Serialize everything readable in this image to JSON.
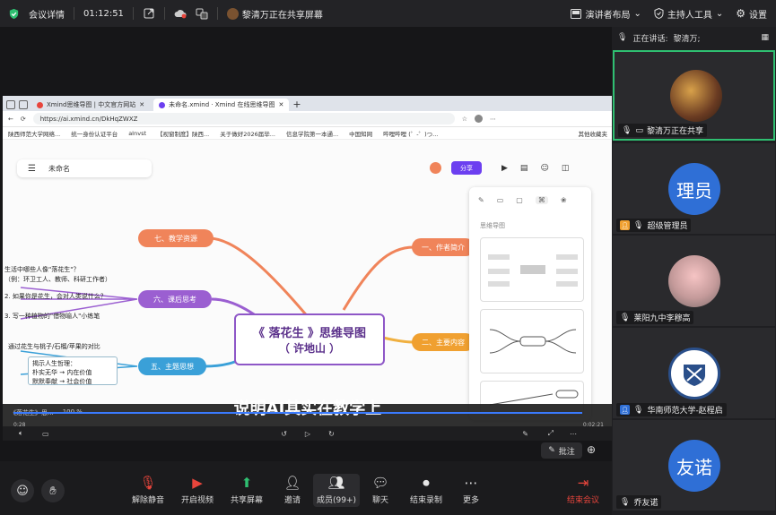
{
  "topbar": {
    "meeting_details": "会议详情",
    "timer": "01:12:51",
    "sharing_notice": "黎清万正在共享屏幕",
    "layout": "演讲者布局",
    "host_tools": "主持人工具",
    "settings": "设置"
  },
  "browser": {
    "tabs": [
      "Xmind思维导图 | 中文官方网站",
      "未命名.xmind · Xmind 在线思维导图"
    ],
    "url": "https://ai.xmind.cn/DkHqZWXZ",
    "bookmarks": [
      "陕西师范大学网络...",
      "统一身份认证平台",
      "aInvst",
      "【视窗制度】陕西...",
      "关于做好2026届毕...",
      "信息学院第一本通...",
      "中国知网",
      "哔哩哔哩 (゜-゜)つ..."
    ],
    "bookmarks_right": "其他收藏夹"
  },
  "xmind": {
    "doc_title": "未命名",
    "share_label": "分享",
    "panel_title": "思维导图",
    "center_line1": "《 落花生 》思维导图",
    "center_line2": "（ 许地山 ）",
    "branches": {
      "b1": "一、作者简介",
      "b2": "二、主要内容",
      "b5": "五、主题思想",
      "b6": "六、课后思考",
      "b7": "七、教学资源"
    },
    "leaves": {
      "l1": "生活中哪些人像\"落花生\"？",
      "l2": "（例：环卫工人、教师、科研工作者）",
      "l3": "2. 如果你是花生，会对人类说什么？",
      "l4": "3. 写一种植物的\"借物喻人\"小练笔",
      "l5": "通过花生与桃子/石榴/苹果的对比",
      "l6": "揭示人生哲理：",
      "l7": "朴实无华 → 内在价值",
      "l8": "默默奉献 → 社会价值"
    }
  },
  "video": {
    "subtitle": "说明AI其实在教学上",
    "elapsed": "0:28",
    "remaining": "0:02:21",
    "file_label": "《落花生》思...",
    "zoom": "100 %"
  },
  "annotate_label": "批注",
  "speaking": {
    "prefix": "正在讲话:",
    "name": "黎清万;"
  },
  "participants": [
    {
      "name": "黎清万正在共享",
      "avatar_text": "",
      "badge": "share"
    },
    {
      "name": "超级管理员",
      "avatar_text": "理员",
      "badge": "host"
    },
    {
      "name": "莱阳九中李穆高",
      "avatar_text": "",
      "badge": ""
    },
    {
      "name": "华南师范大学-赵程启",
      "avatar_text": "",
      "badge": "user"
    },
    {
      "name": "乔友诺",
      "avatar_text": "友诺",
      "badge": ""
    }
  ],
  "controls": {
    "unmute": "解除静音",
    "video": "开启视频",
    "share": "共享屏幕",
    "invite": "邀请",
    "members": "成员(99+)",
    "chat": "聊天",
    "record": "结束录制",
    "more": "更多",
    "end": "结束会议"
  },
  "colors": {
    "accent_green": "#2fbf71",
    "end_red": "#e8453c",
    "avatar_blue": "#2f6fd6",
    "branch_orange": "#f0845a",
    "branch_purple": "#9b5fd1",
    "branch_blue": "#3aa0d8"
  }
}
